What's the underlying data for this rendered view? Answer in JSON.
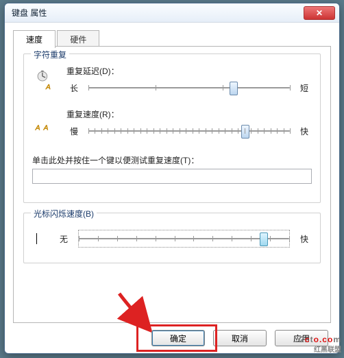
{
  "window": {
    "title": "键盘 属性",
    "close_glyph": "✕"
  },
  "tabs": {
    "speed": "速度",
    "hardware": "硬件"
  },
  "char_repeat": {
    "legend": "字符重复",
    "delay_label": "重复延迟(D)：",
    "delay_min": "长",
    "delay_max": "短",
    "rate_label": "重复速度(R)：",
    "rate_min": "慢",
    "rate_max": "快",
    "test_label": "单击此处并按住一个键以便测试重复速度(T)：",
    "test_value": ""
  },
  "cursor_blink": {
    "legend": "光标闪烁速度(B)",
    "min": "无",
    "max": "快"
  },
  "buttons": {
    "ok": "确定",
    "cancel": "取消",
    "apply": "应用"
  },
  "sliders": {
    "delay_percent": 72,
    "rate_percent": 78,
    "blink_percent": 88
  },
  "watermark": {
    "line1": "2cto.com",
    "line2": "红黑联盟"
  }
}
